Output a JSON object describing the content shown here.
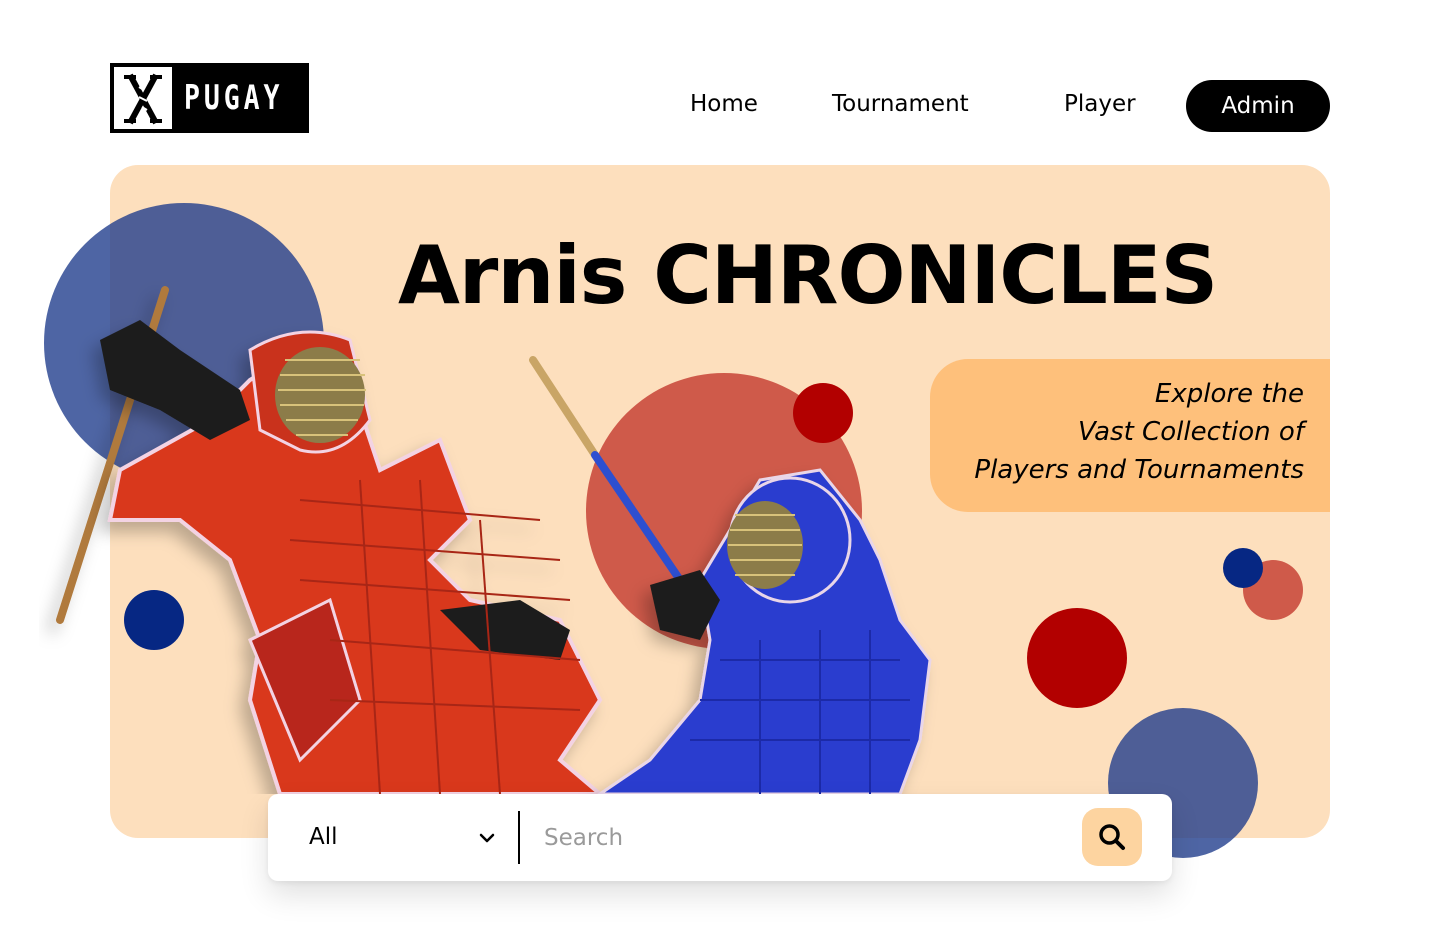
{
  "header": {
    "logo_text": "PUGAY",
    "nav": {
      "home": "Home",
      "tournament": "Tournament",
      "player": "Player",
      "admin": "Admin"
    }
  },
  "hero": {
    "title": "Arnis CHRONICLES",
    "tagline": {
      "line1": "Explore the",
      "line2": "Vast Collection of",
      "line3": "Players and Tournaments"
    },
    "image_alt": "arnis-fighters-red-and-blue"
  },
  "search": {
    "filter_selected": "All",
    "placeholder": "Search",
    "value": ""
  },
  "colors": {
    "hero_bg": "#fddfbd",
    "tagline_bg": "#fec07b",
    "accent_blue": "#1c3a8a",
    "accent_red": "#b20000",
    "accent_coral": "#cf5a4a",
    "search_button_bg": "#fdd4a0"
  },
  "icons": {
    "logo": "crossed-sticks-icon",
    "filter": "chevron-down-icon",
    "search": "search-icon"
  }
}
